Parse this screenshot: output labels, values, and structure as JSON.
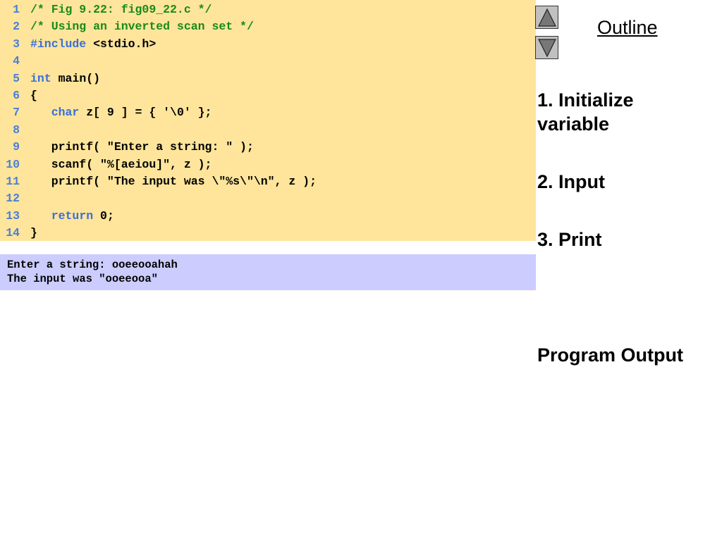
{
  "code": [
    {
      "n": "1",
      "segs": [
        {
          "t": "/* Fig 9.22: fig09_22.c */",
          "c": "cm"
        }
      ]
    },
    {
      "n": "2",
      "segs": [
        {
          "t": "/* Using an inverted scan set */",
          "c": "cm"
        }
      ]
    },
    {
      "n": "3",
      "segs": [
        {
          "t": "#include",
          "c": "kw"
        },
        {
          "t": " <stdio.h>",
          "c": "tx"
        }
      ]
    },
    {
      "n": "4",
      "segs": []
    },
    {
      "n": "5",
      "segs": [
        {
          "t": "int",
          "c": "kw"
        },
        {
          "t": " main()",
          "c": "tx"
        }
      ]
    },
    {
      "n": "6",
      "segs": [
        {
          "t": "{",
          "c": "tx"
        }
      ]
    },
    {
      "n": "7",
      "segs": [
        {
          "t": "   ",
          "c": "tx"
        },
        {
          "t": "char",
          "c": "kw"
        },
        {
          "t": " z[ 9 ] = { '\\0' };",
          "c": "tx"
        }
      ]
    },
    {
      "n": "8",
      "segs": []
    },
    {
      "n": "9",
      "segs": [
        {
          "t": "   printf( \"Enter a string: \" );",
          "c": "tx"
        }
      ]
    },
    {
      "n": "10",
      "segs": [
        {
          "t": "   scanf( \"%[aeiou]\", z );",
          "c": "tx"
        }
      ]
    },
    {
      "n": "11",
      "segs": [
        {
          "t": "   printf( \"The input was \\\"%s\\\"\\n\", z );",
          "c": "tx"
        }
      ]
    },
    {
      "n": "12",
      "segs": []
    },
    {
      "n": "13",
      "segs": [
        {
          "t": "   ",
          "c": "tx"
        },
        {
          "t": "return",
          "c": "kw"
        },
        {
          "t": " 0;",
          "c": "tx"
        }
      ]
    },
    {
      "n": "14",
      "segs": [
        {
          "t": "}",
          "c": "tx"
        }
      ]
    }
  ],
  "output": [
    "Enter a string: ooeeooahah",
    "The input was \"ooeeooa\""
  ],
  "outline": {
    "title": "Outline",
    "steps": [
      "1. Initialize variable",
      "2. Input",
      "3. Print",
      "Program Output"
    ]
  }
}
